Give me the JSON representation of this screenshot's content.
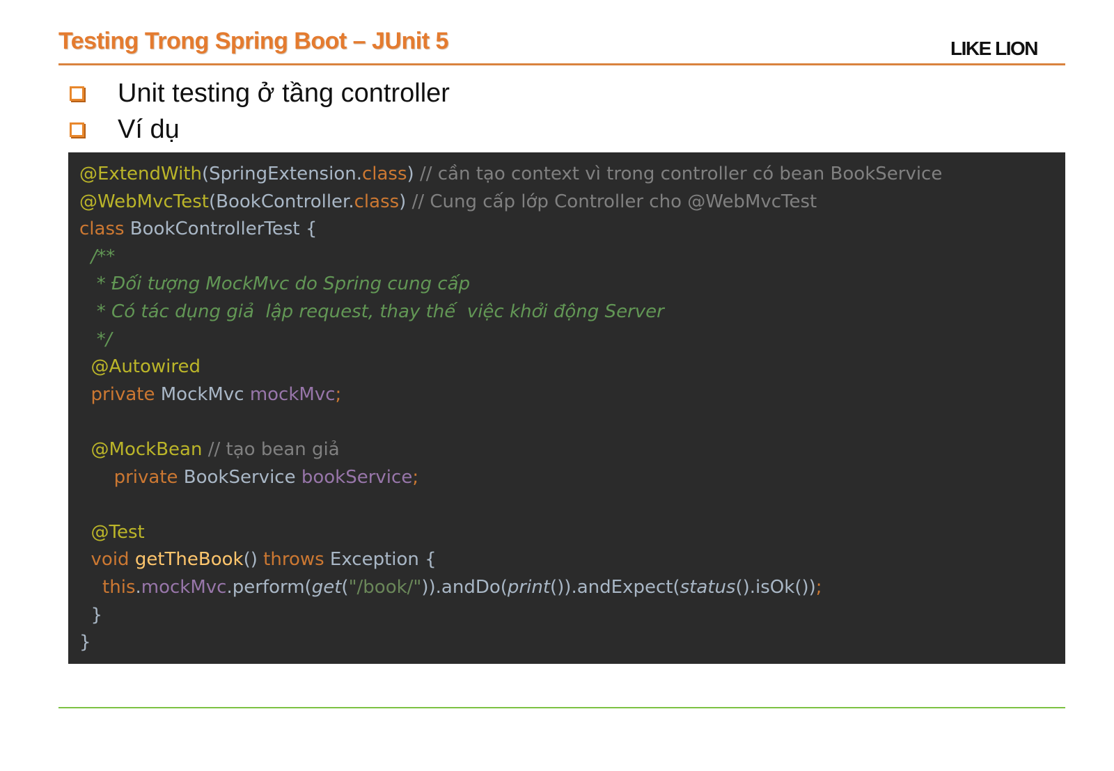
{
  "slide": {
    "title": "Testing Trong Spring Boot – JUnit 5",
    "brand": "LIKE LION"
  },
  "bullets": [
    {
      "text": "Unit testing ở tầng controller"
    },
    {
      "text": "Ví dụ"
    }
  ],
  "code": {
    "l1_ann": "@ExtendWith",
    "l1_a": "(SpringExtension.",
    "l1_kw": "class",
    "l1_b": ") ",
    "l1_cmt": "// cần tạo context vì trong controller có bean BookService",
    "l2_ann": "@WebMvcTest",
    "l2_a": "(BookController.",
    "l2_kw": "class",
    "l2_b": ") ",
    "l2_cmt": "// Cung cấp lớp Controller cho @WebMvcTest",
    "l3_kw": "class",
    "l3_a": " BookControllerTest {",
    "l4_doc": "  /**",
    "l5_doc": "   * Đối tượng MockMvc do Spring cung cấp",
    "l6_doc": "   * Có tác dụng giả  lập request, thay thế  việc khởi động Server",
    "l7_doc": "   */",
    "l8_ann": "  @Autowired",
    "l9_kw": "  private",
    "l9_a": " MockMvc ",
    "l9_fld": "mockMvc",
    "l9_semi": ";",
    "l11_ann": "  @MockBean",
    "l11_cmt": " // tạo bean giả",
    "l12_kw": "      private",
    "l12_a": " BookService ",
    "l12_fld": "bookService",
    "l12_semi": ";",
    "l14_ann": "  @Test",
    "l15_kw": "  void",
    "l15_fn": " getTheBook",
    "l15_a": "() ",
    "l15_kw2": "throws",
    "l15_b": " Exception {",
    "l16_kw": "    this",
    "l16_dot": ".",
    "l16_fld": "mockMvc",
    "l16_a": ".perform(",
    "l16_get": "get",
    "l16_b": "(",
    "l16_str": "\"/book/\"",
    "l16_c": ")).andDo(",
    "l16_print": "print",
    "l16_d": "()).andExpect(",
    "l16_status": "status",
    "l16_e": "().isOk())",
    "l16_semi": ";",
    "l17": "  }",
    "l18": "}"
  }
}
